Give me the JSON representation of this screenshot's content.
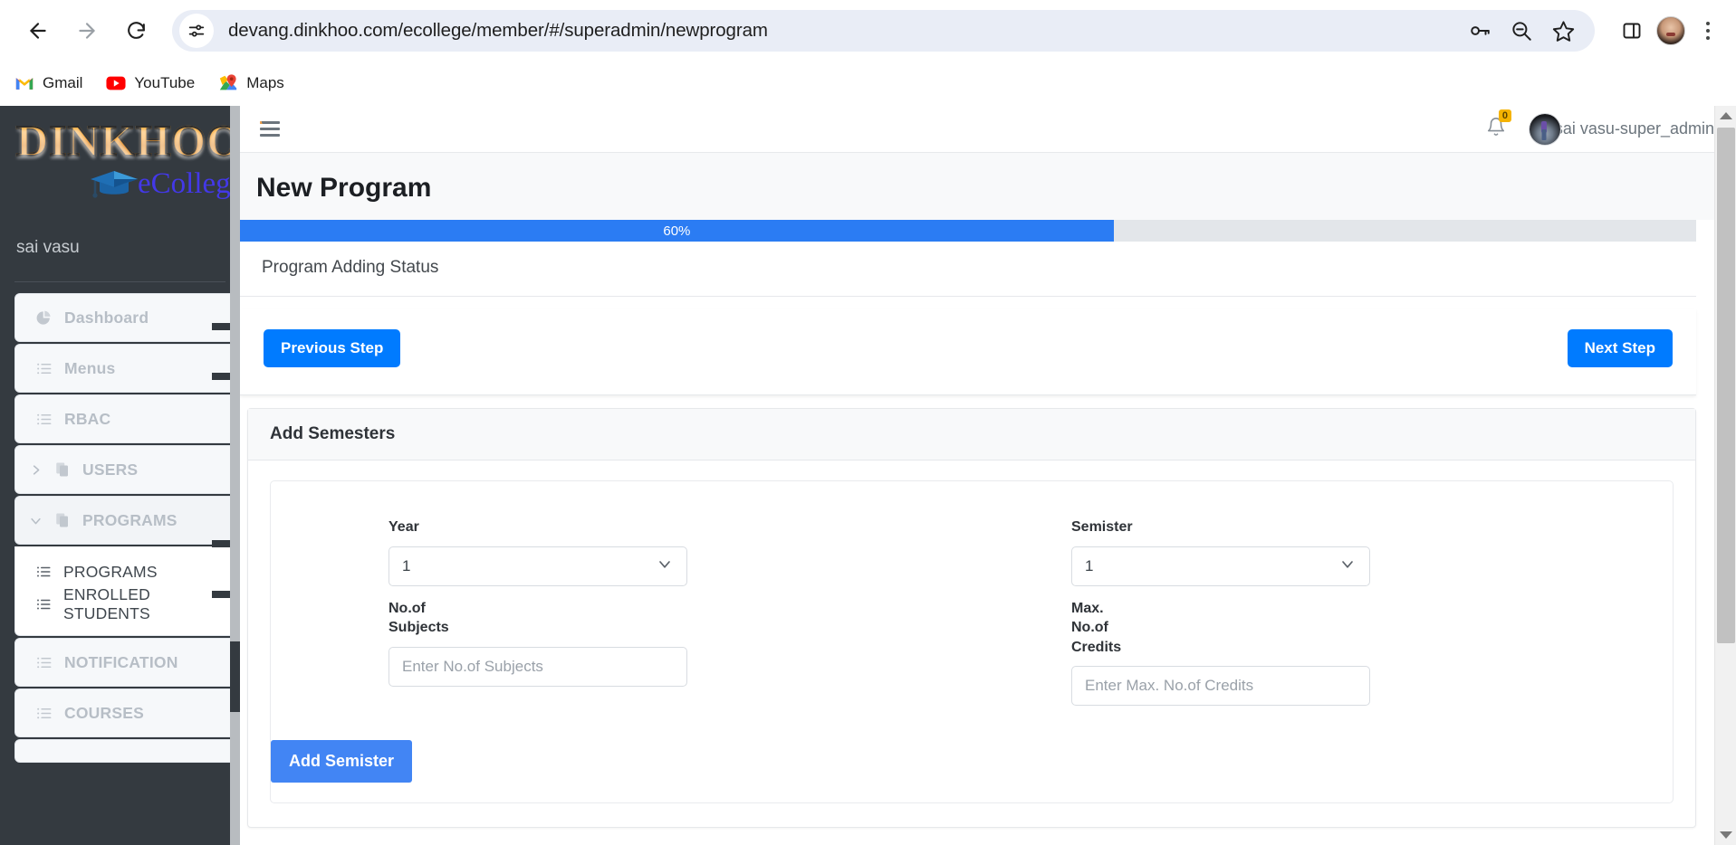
{
  "browser": {
    "url": "devang.dinkhoo.com/ecollege/member/#/superadmin/newprogram",
    "back_label": "Back",
    "forward_label": "Forward",
    "reload_label": "Reload",
    "site_info_label": "View site information",
    "password_label": "Passwords",
    "zoom_label": "Zoom out",
    "bookmark_label": "Bookmark this tab",
    "side_panel_label": "Side panel",
    "profile_label": "Profile",
    "menu_label": "Customize and control Google Chrome",
    "bookmarks": [
      {
        "label": "Gmail",
        "icon": "gmail-icon"
      },
      {
        "label": "YouTube",
        "icon": "youtube-icon"
      },
      {
        "label": "Maps",
        "icon": "maps-icon"
      }
    ]
  },
  "sidebar": {
    "logo_word": "DINKHOO!",
    "logo_sub": "eCollege",
    "user": "sai vasu",
    "items": [
      {
        "label": "Dashboard",
        "icon": "pie-chart-icon",
        "expandable": false
      },
      {
        "label": "Menus",
        "icon": "list-icon",
        "expandable": false
      },
      {
        "label": "RBAC",
        "icon": "list-icon",
        "expandable": false
      },
      {
        "label": "USERS",
        "icon": "copy-icon",
        "expandable": true,
        "expanded": false
      },
      {
        "label": "PROGRAMS",
        "icon": "copy-icon",
        "expandable": true,
        "expanded": true
      },
      {
        "label": "NOTIFICATION",
        "icon": "list-icon",
        "expandable": false
      },
      {
        "label": "COURSES",
        "icon": "list-icon",
        "expandable": false
      }
    ],
    "programs_children": [
      {
        "label": "PROGRAMS",
        "icon": "list-icon"
      },
      {
        "label": "ENROLLED STUDENTS",
        "icon": "list-icon"
      }
    ]
  },
  "topbar": {
    "menu_toggle": "hamburger-icon",
    "notification_icon": "bell-icon",
    "notification_count": "0",
    "user_name": "sai vasu-super_admin"
  },
  "page": {
    "title": "New Program",
    "progress_percent": "60%",
    "progress_value": 60,
    "progress_label": "Program Adding Status",
    "previous_step": "Previous Step",
    "next_step": "Next Step",
    "section_title": "Add Semesters",
    "fields": {
      "year_label": "Year",
      "year_value": "1",
      "semister_label": "Semister",
      "semister_value": "1",
      "subjects_label": "No.of Subjects",
      "subjects_value": "",
      "subjects_placeholder": "Enter No.of Subjects",
      "credits_label": "Max. No.of Credits",
      "credits_value": "",
      "credits_placeholder": "Enter Max. No.of Credits"
    },
    "add_semister": "Add Semister"
  },
  "colors": {
    "accent_blue": "#007bff",
    "progress_blue": "#2b7cf3",
    "add_button_blue": "#4285f4",
    "sidebar_dark": "#343a40",
    "badge_yellow": "#f5b301",
    "logo_orange": "#f79a21",
    "logo_purple": "#4338e8"
  }
}
